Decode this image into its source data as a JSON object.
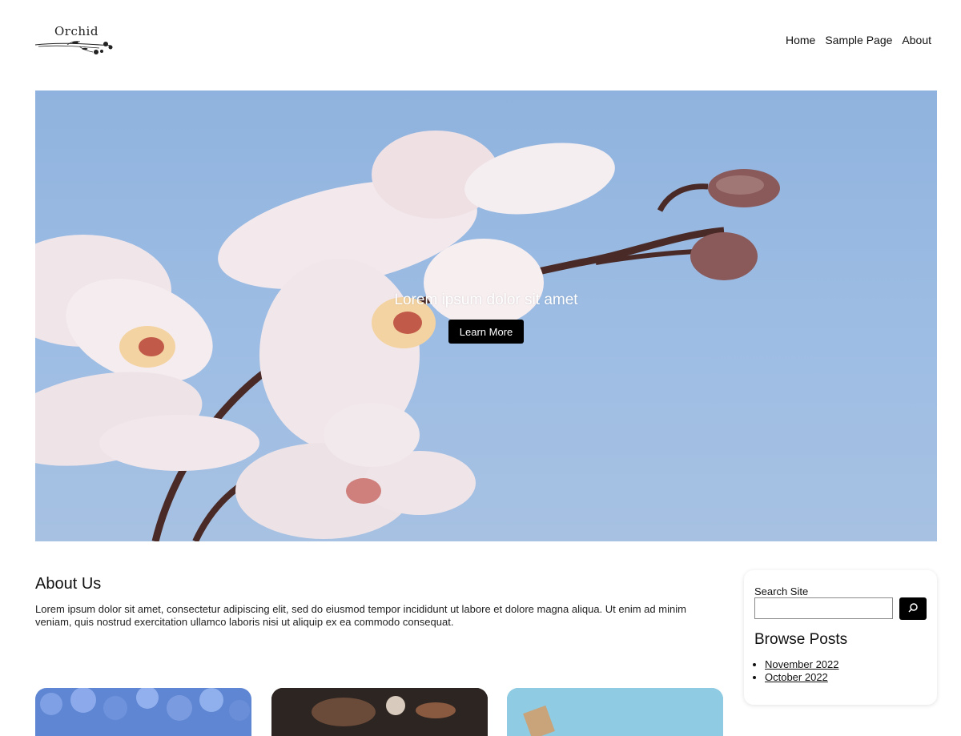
{
  "site": {
    "logo_text": "Orchid"
  },
  "nav": {
    "items": [
      {
        "label": "Home"
      },
      {
        "label": "Sample Page"
      },
      {
        "label": "About"
      }
    ]
  },
  "hero": {
    "title": "Lorem ipsum dolor sit amet",
    "button_label": "Learn More"
  },
  "about": {
    "heading": "About Us",
    "body": "Lorem ipsum dolor sit amet, consectetur adipiscing elit, sed do eiusmod tempor incididunt ut labore et dolore magna aliqua. Ut enim ad minim veniam, quis nostrud exercitation ullamco laboris nisi ut aliquip ex ea commodo consequat."
  },
  "sidebar": {
    "search_label": "Search Site",
    "search_value": "",
    "search_icon": "search-icon",
    "browse_title": "Browse Posts",
    "archives": [
      {
        "label": "November 2022"
      },
      {
        "label": "October 2022"
      }
    ]
  },
  "colors": {
    "sky": "#9ebde4",
    "button": "#000000"
  }
}
